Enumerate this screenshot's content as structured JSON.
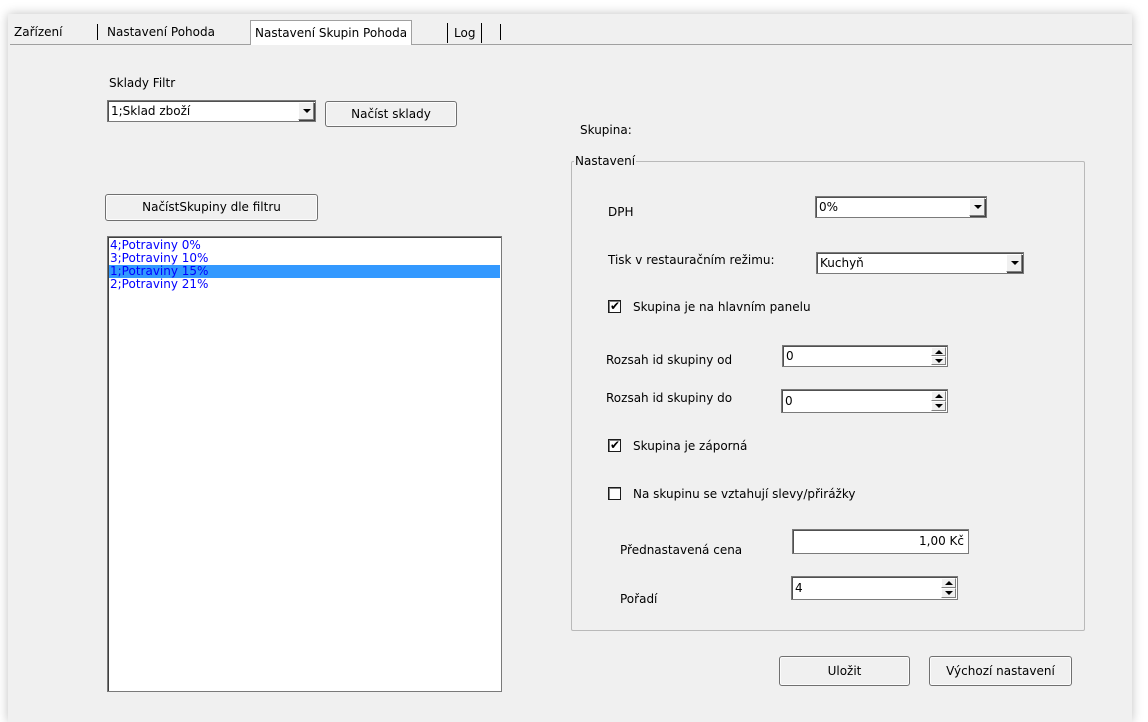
{
  "tabs": [
    {
      "label": "Zařízení"
    },
    {
      "label": "Nastavení Pohoda"
    },
    {
      "label": "Nastavení Skupin Pohoda"
    },
    {
      "label": "Log"
    }
  ],
  "active_tab": "Nastavení Skupin Pohoda",
  "sklady": {
    "filter_label": "Sklady Filtr",
    "selected": "1;Sklad zboží",
    "load_button": "Načíst sklady"
  },
  "groups": {
    "load_button": "NačístSkupiny dle filtru",
    "items": [
      {
        "label": "4;Potraviny 0%",
        "selected": false
      },
      {
        "label": "3;Potraviny 10%",
        "selected": false
      },
      {
        "label": "1;Potraviny 15%",
        "selected": true
      },
      {
        "label": "2;Potraviny 21%",
        "selected": false
      }
    ]
  },
  "skupina_label": "Skupina:",
  "settings": {
    "title": "Nastavení",
    "dph_label": "DPH",
    "dph_value": "0%",
    "tisk_label": "Tisk v restauračním režimu:",
    "tisk_value": "Kuchyň",
    "main_panel_label": "Skupina je na hlavním panelu",
    "main_panel_checked": true,
    "range_from_label": "Rozsah id skupiny od",
    "range_from_value": "0",
    "range_to_label": "Rozsah id skupiny do",
    "range_to_value": "0",
    "negative_label": "Skupina je záporná",
    "negative_checked": true,
    "discounts_label": "Na skupinu se vztahují slevy/přirážky",
    "discounts_checked": false,
    "price_label": "Přednastavená cena",
    "price_value": "1,00 Kč",
    "order_label": "Pořadí",
    "order_value": "4"
  },
  "actions": {
    "save": "Uložit",
    "defaults": "Výchozí nastavení"
  },
  "colors": {
    "list_text": "#0000ff",
    "selection_bg": "#3399ff",
    "selection_text": "#ffffff"
  }
}
